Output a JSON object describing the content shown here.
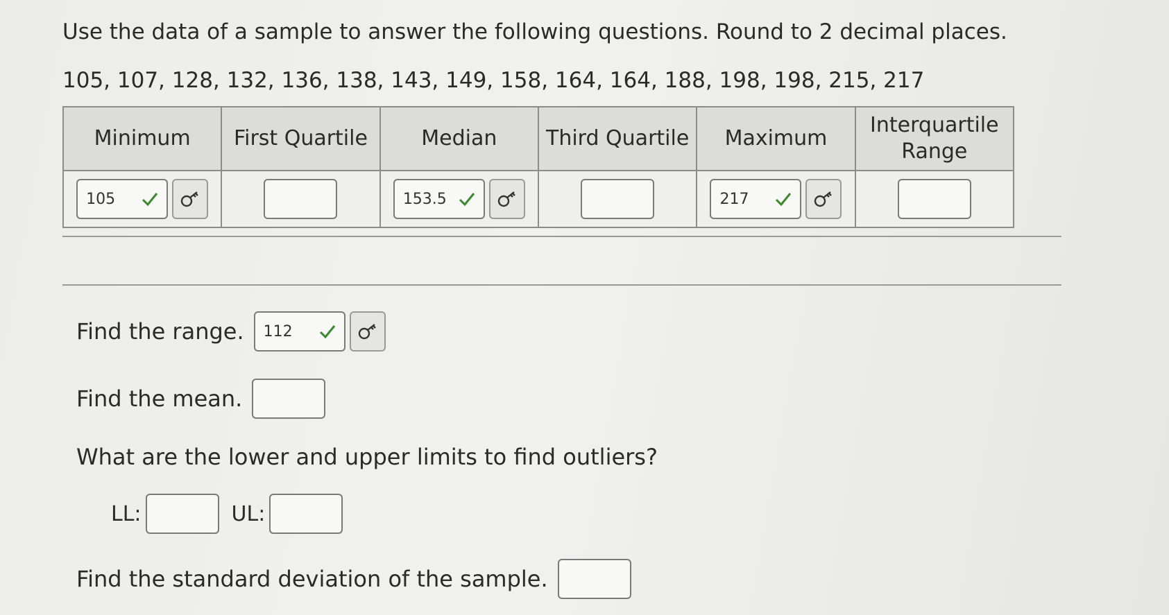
{
  "question": {
    "prompt": "Use the data of a sample to answer the following questions. Round to 2 decimal places.",
    "dataset": "105, 107, 128, 132, 136, 138, 143, 149, 158, 164, 164, 188, 198, 198, 215, 217"
  },
  "table": {
    "headers": [
      "Minimum",
      "First Quartile",
      "Median",
      "Third Quartile",
      "Maximum",
      "Interquartile Range"
    ],
    "values": {
      "minimum": "105",
      "first_quartile": "",
      "median": "153.5",
      "third_quartile": "",
      "maximum": "217",
      "iqr": ""
    }
  },
  "range": {
    "label": "Find the range.",
    "value": "112"
  },
  "mean": {
    "label": "Find the mean.",
    "value": ""
  },
  "outliers": {
    "label": "What are the lower and upper limits to find outliers?",
    "ll_label": "LL:",
    "ul_label": "UL:",
    "ll_value": "",
    "ul_value": ""
  },
  "stdev": {
    "label": "Find the standard deviation of the sample.",
    "value": ""
  },
  "icons": {
    "correct": "check-icon",
    "answer_key": "key-icon"
  },
  "colors": {
    "correct": "#3a8a2c"
  }
}
